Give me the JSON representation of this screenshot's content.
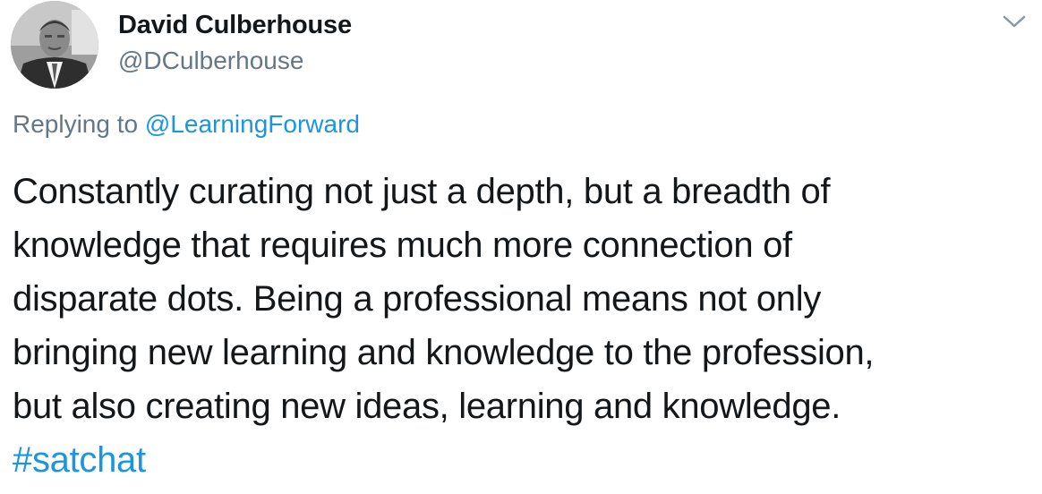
{
  "author": {
    "display_name": "David Culberhouse",
    "handle": "@DCulberhouse",
    "avatar_icon": "profile-photo-grayscale"
  },
  "menu": {
    "icon": "chevron-down-icon"
  },
  "reply": {
    "prefix": "Replying to",
    "target": "@LearningForward"
  },
  "tweet": {
    "lines": [
      "Constantly curating not just a depth, but a breadth of",
      "knowledge that requires much more connection of",
      "disparate dots. Being a professional means not only",
      "bringing new learning and knowledge to the profession,",
      "but also creating new ideas, learning and knowledge."
    ],
    "hashtag": "#satchat"
  },
  "colors": {
    "text": "#14171a",
    "secondary": "#657786",
    "link": "#1b95e0"
  }
}
